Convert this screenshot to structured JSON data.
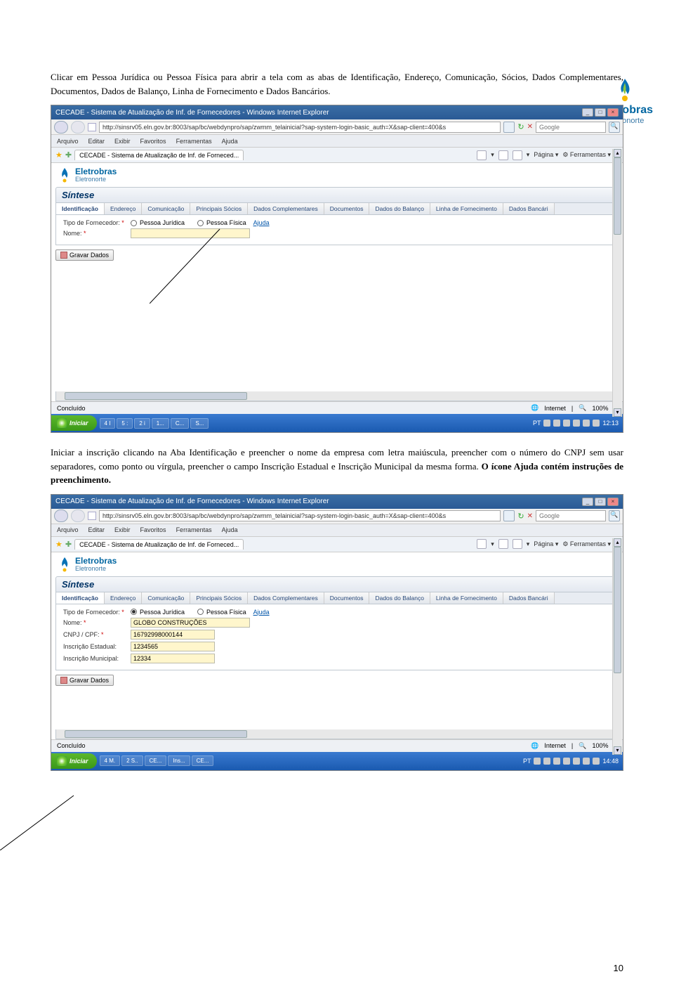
{
  "logo": {
    "main": "Eletrobras",
    "sub": "Eletronorte"
  },
  "paragraphs": {
    "p1": "Clicar em Pessoa Jurídica ou Pessoa Física para abrir a tela com as abas de Identificação, Endereço, Comunicação, Sócios, Dados Complementares, Documentos, Dados de Balanço, Linha de Fornecimento e Dados Bancários.",
    "p2a": "Iniciar a inscrição clicando na Aba Identificação e preencher o nome da empresa com letra maiúscula, preencher com o número do CNPJ sem usar separadores, como ponto ou vírgula, preencher o campo Inscrição Estadual e Inscrição Municipal da mesma forma. ",
    "p2b": "O ícone Ajuda contém instruções de preenchimento."
  },
  "window": {
    "title": "CECADE - Sistema de Atualização de Inf. de Fornecedores - Windows Internet Explorer",
    "url": "http://sinsrv05.eln.gov.br:8003/sap/bc/webdynpro/sap/zwmm_telainicial?sap-system-login-basic_auth=X&sap-client=400&s",
    "search_placeholder": "Google",
    "menus": [
      "Arquivo",
      "Editar",
      "Exibir",
      "Favoritos",
      "Ferramentas",
      "Ajuda"
    ],
    "tab_title": "CECADE - Sistema de Atualização de Inf. de Forneced...",
    "toolbar_right": {
      "pagina": "Página",
      "ferramentas": "Ferramentas"
    },
    "status_left": "Concluído",
    "status_internet": "Internet",
    "status_zoom": "100%"
  },
  "app": {
    "brand_main": "Eletrobras",
    "brand_sub": "Eletronorte",
    "sintese": "Síntese",
    "tabs": [
      "Identificação",
      "Endereço",
      "Comunicação",
      "Principais Sócios",
      "Dados Complementares",
      "Documentos",
      "Dados do Balanço",
      "Linha de Fornecimento",
      "Dados Bancári"
    ],
    "labels": {
      "tipo": "Tipo de Fornecedor:",
      "pj": "Pessoa Jurídica",
      "pf": "Pessoa Física",
      "ajuda": "Ajuda",
      "nome": "Nome:",
      "cnpj": "CNPJ / CPF:",
      "insc_est": "Inscrição Estadual:",
      "insc_mun": "Inscrição Municipal:",
      "gravar": "Gravar Dados"
    },
    "values2": {
      "nome": "GLOBO CONSTRUÇÕES",
      "cnpj": "16792998000144",
      "insc_est": "1234565",
      "insc_mun": "12334"
    }
  },
  "taskbar": {
    "start": "Iniciar",
    "tasks1": [
      "4 I",
      "5 :",
      "2 i",
      "1...",
      "C...",
      "S..."
    ],
    "tray1_lang": "PT",
    "clock1": "12:13",
    "tasks2": [
      "4 M.",
      "2 S..",
      "CE...",
      "Ins...",
      "CE..."
    ],
    "clock2": "14:48"
  },
  "page_number": "10"
}
